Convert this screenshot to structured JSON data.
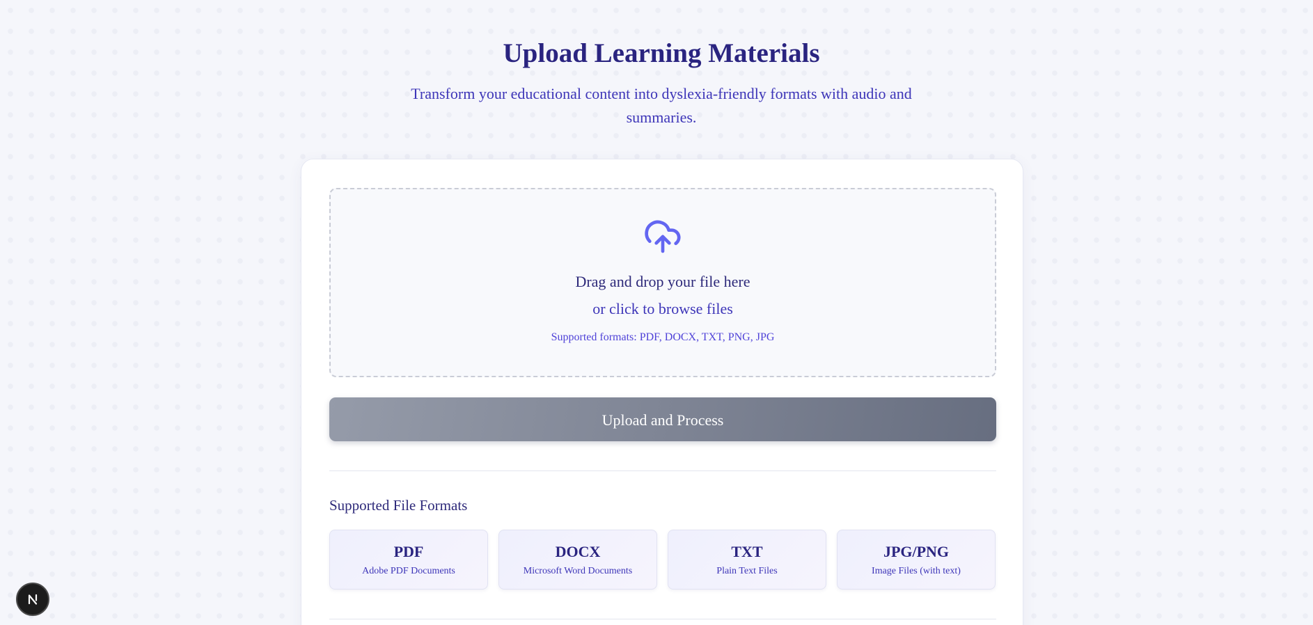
{
  "header": {
    "title": "Upload Learning Materials",
    "subtitle": "Transform your educational content into dyslexia-friendly formats with audio and summaries."
  },
  "dropzone": {
    "icon": "cloud-upload-icon",
    "title": "Drag and drop your file here",
    "browse_label": "or click to browse files",
    "formats_hint": "Supported formats: PDF, DOCX, TXT, PNG, JPG"
  },
  "upload_button": {
    "label": "Upload and Process",
    "state": "disabled"
  },
  "formats_section": {
    "heading": "Supported File Formats",
    "items": [
      {
        "name": "PDF",
        "description": "Adobe PDF Documents"
      },
      {
        "name": "DOCX",
        "description": "Microsoft Word Documents"
      },
      {
        "name": "TXT",
        "description": "Plain Text Files"
      },
      {
        "name": "JPG/PNG",
        "description": "Image Files (with text)"
      }
    ]
  },
  "dev_badge": {
    "icon": "nextjs-logo-icon",
    "letter": "N"
  },
  "colors": {
    "accent": "#6366f1",
    "heading": "#2a2480",
    "text_indigo": "#3d35b8",
    "button_gradient_start": "#959ba9",
    "button_gradient_end": "#676e80"
  }
}
